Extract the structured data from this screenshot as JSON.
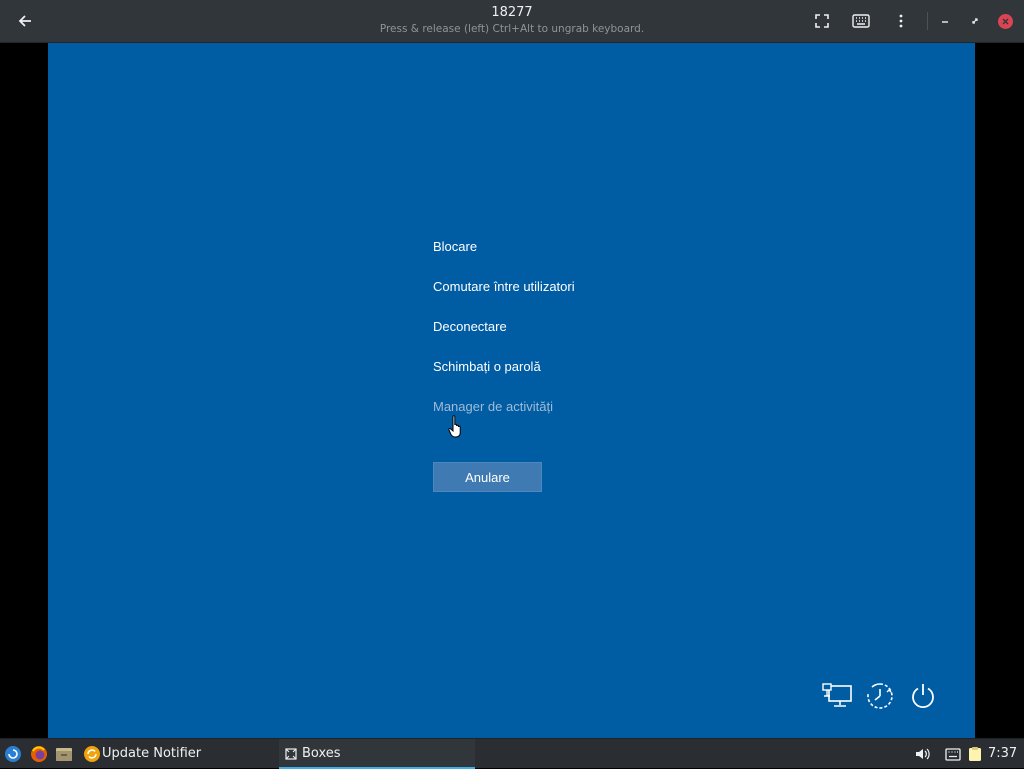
{
  "headerbar": {
    "title": "18277",
    "subtitle": "Press & release (left) Ctrl+Alt to ungrab keyboard.",
    "back_icon": "back-arrow-icon",
    "fullscreen_icon": "fullscreen-icon",
    "keyboard_icon": "keyboard-icon",
    "menu_icon": "kebab-menu-icon",
    "minimize_icon": "minimize-icon",
    "restore_icon": "restore-icon",
    "close_icon": "close-icon"
  },
  "vm_screen": {
    "background": "#005da4",
    "options": [
      {
        "label": "Blocare"
      },
      {
        "label": "Comutare între utilizatori"
      },
      {
        "label": "Deconectare"
      },
      {
        "label": "Schimbați o parolă"
      },
      {
        "label": "Manager de activități"
      }
    ],
    "cancel_label": "Anulare",
    "corner_icons": [
      "network-icon",
      "ease-of-access-icon",
      "power-icon"
    ]
  },
  "taskbar": {
    "launcher_icon": "start-menu-icon",
    "firefox_icon": "firefox-icon",
    "files_icon": "file-manager-icon",
    "update_notifier_label": "Update Notifier",
    "boxes_label": "Boxes",
    "clock": "7:37",
    "tray_icons": [
      "volume-icon",
      "keyboard-layout-icon",
      "clipboard-icon"
    ]
  },
  "colors": {
    "accent": "#3daee9",
    "close": "#da4453",
    "cancel_button": "#3f7ab2"
  }
}
